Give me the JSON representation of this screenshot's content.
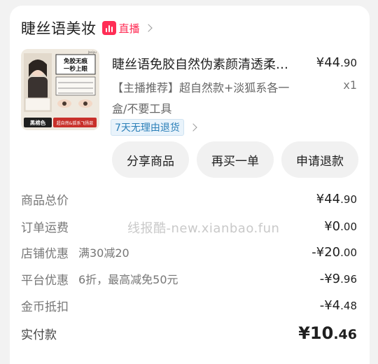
{
  "shop": {
    "name": "睫丝语美妆",
    "live_label": "直播"
  },
  "product": {
    "title": "睫丝语免胶自然伪素颜清透柔…",
    "price_int": "¥44",
    "price_dec": ".90",
    "variant": "【主播推荐】超自然款+淡狐系各一盒/不要工具",
    "quantity": "x1",
    "return_tag": "7天无理由退货",
    "thumbnail": {
      "headline": "免胶无痕 一秒上眼",
      "brand": "Jasiyu",
      "badge_left": "黑棉色",
      "badge_right": "超自然&狐系飞扬款",
      "accent_color": "#c8302a"
    }
  },
  "actions": {
    "share": "分享商品",
    "rebuy": "再买一单",
    "refund": "申请退款"
  },
  "summary": {
    "items_total": {
      "label": "商品总价",
      "int": "¥44",
      "dec": ".90"
    },
    "shipping": {
      "label": "订单运费",
      "int": "¥0",
      "dec": ".00"
    },
    "shop_discount": {
      "label": "店铺优惠",
      "detail": "满30减20",
      "int": "-¥20",
      "dec": ".00"
    },
    "platform_discount": {
      "label": "平台优惠",
      "detail": "6折，最高减免50元",
      "int": "-¥9",
      "dec": ".96"
    },
    "coins": {
      "label": "金币抵扣",
      "int": "-¥4",
      "dec": ".48"
    },
    "paid": {
      "label": "实付款",
      "int": "¥10",
      "dec": ".46"
    }
  },
  "watermark": "线报酷-new.xianbao.fun",
  "colors": {
    "live_red": "#ff2d55",
    "return_blue": "#2a7fb8"
  }
}
